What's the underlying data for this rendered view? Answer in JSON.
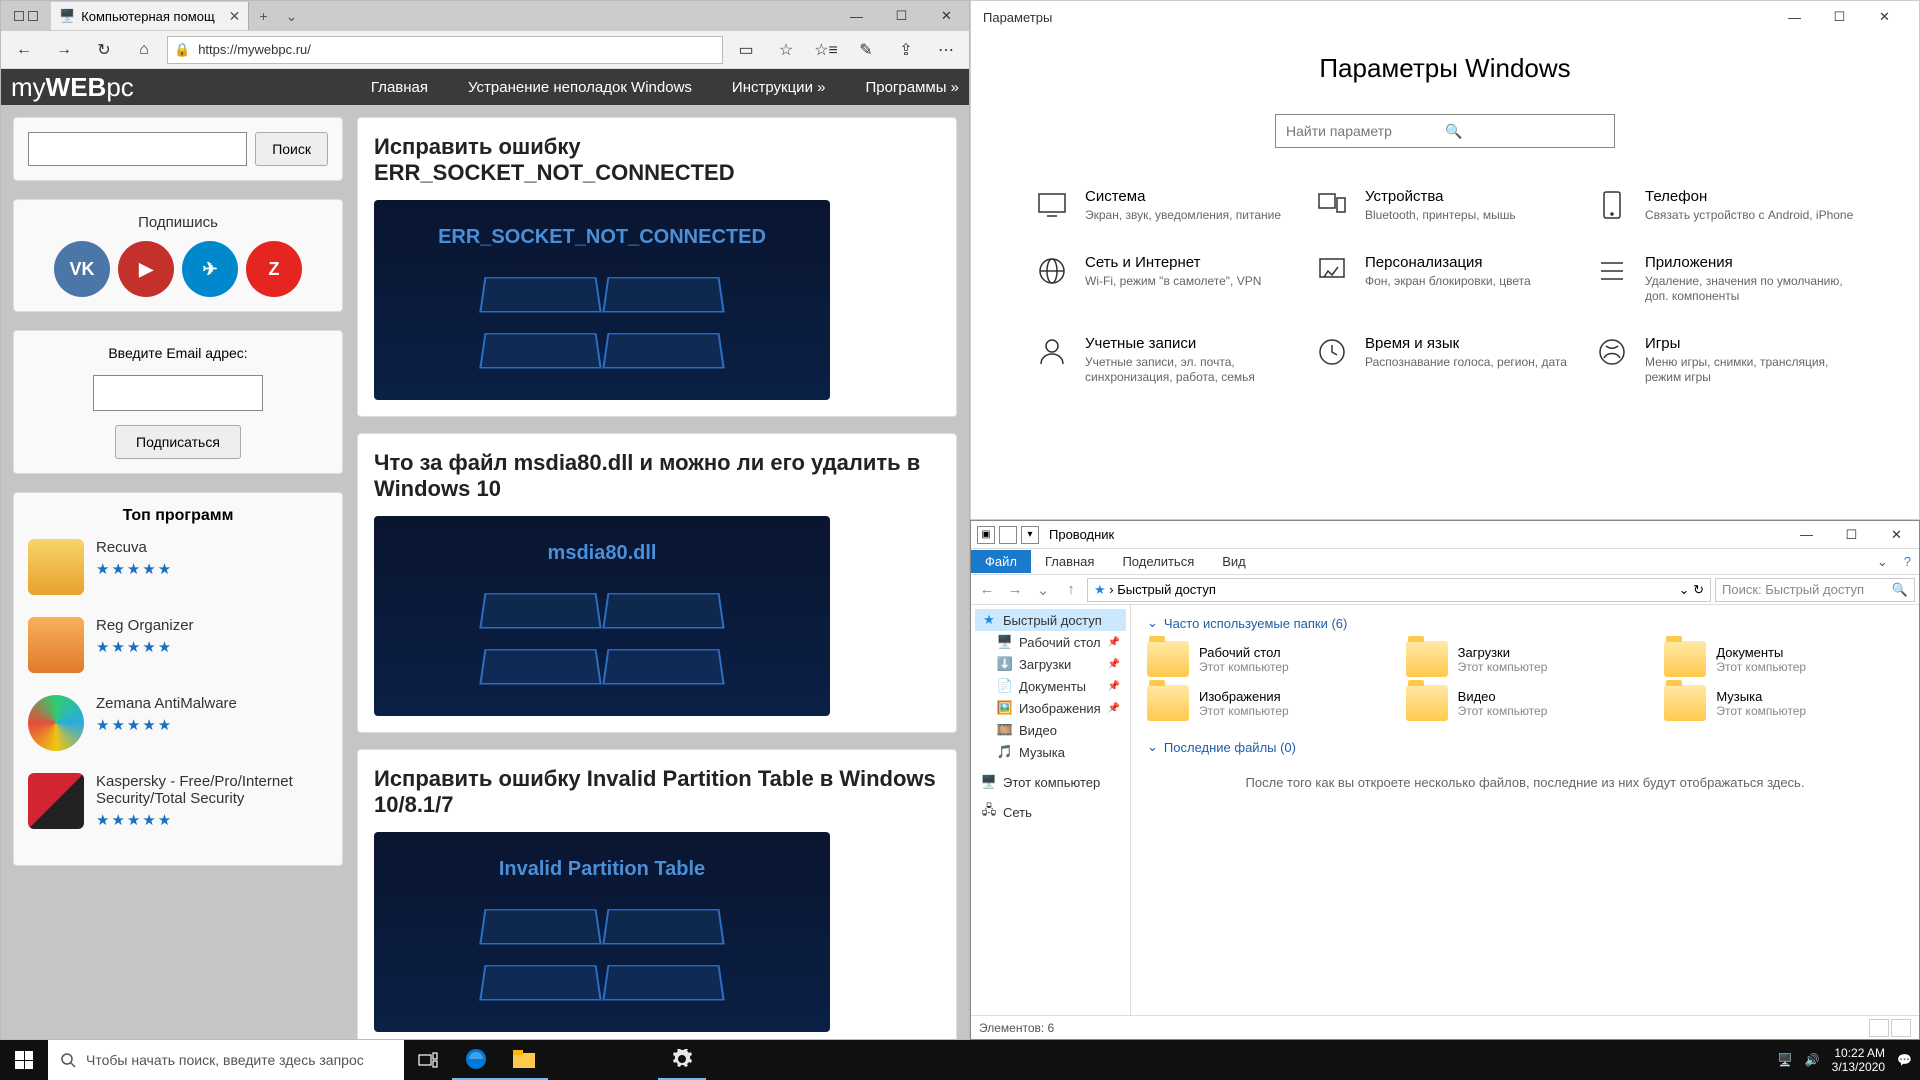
{
  "browser": {
    "tab_title": "Компьютерная помощ",
    "url": "https://mywebpc.ru/",
    "site_logo_a": "my",
    "site_logo_b": "WEB",
    "site_logo_c": "pc",
    "menu": [
      "Главная",
      "Устранение неполадок Windows",
      "Инструкции »",
      "Программы »"
    ],
    "search_btn": "Поиск",
    "subscribe_title": "Подпишись",
    "email_label": "Введите Email адрес:",
    "subscribe_btn": "Подписаться",
    "top_title": "Топ программ",
    "programs": [
      {
        "name": "Recuva",
        "color": "#f7b733"
      },
      {
        "name": "Reg Organizer",
        "color": "#f28c28"
      },
      {
        "name": "Zemana AntiMalware",
        "color": "#29abe2"
      },
      {
        "name": "Kaspersky - Free/Pro/Internet Security/Total Security",
        "color": "#d32431"
      }
    ],
    "articles": [
      {
        "title": "Исправить ошибку ERR_SOCKET_NOT_CONNECTED",
        "caption": "ERR_SOCKET_NOT_CONNECTED"
      },
      {
        "title": "Что за файл msdia80.dll и можно ли его удалить в Windows 10",
        "caption": "msdia80.dll"
      },
      {
        "title": "Исправить ошибку Invalid Partition Table в Windows 10/8.1/7",
        "caption": "Invalid Partition Table"
      }
    ]
  },
  "settings": {
    "window_title": "Параметры",
    "heading": "Параметры Windows",
    "search_placeholder": "Найти параметр",
    "items": [
      {
        "title": "Система",
        "desc": "Экран, звук, уведомления, питание"
      },
      {
        "title": "Устройства",
        "desc": "Bluetooth, принтеры, мышь"
      },
      {
        "title": "Телефон",
        "desc": "Связать устройство с Android, iPhone"
      },
      {
        "title": "Сеть и Интернет",
        "desc": "Wi-Fi, режим \"в самолете\", VPN"
      },
      {
        "title": "Персонализация",
        "desc": "Фон, экран блокировки, цвета"
      },
      {
        "title": "Приложения",
        "desc": "Удаление, значения по умолчанию, доп. компоненты"
      },
      {
        "title": "Учетные записи",
        "desc": "Учетные записи, эл. почта, синхронизация, работа, семья"
      },
      {
        "title": "Время и язык",
        "desc": "Распознавание голоса, регион, дата"
      },
      {
        "title": "Игры",
        "desc": "Меню игры, снимки, трансляция, режим игры"
      }
    ]
  },
  "explorer": {
    "title": "Проводник",
    "ribbon": {
      "file": "Файл",
      "home": "Главная",
      "share": "Поделиться",
      "view": "Вид"
    },
    "breadcrumb": "Быстрый доступ",
    "search_placeholder": "Поиск: Быстрый доступ",
    "tree": {
      "quick": "Быстрый доступ",
      "desktop": "Рабочий стол",
      "downloads": "Загрузки",
      "documents": "Документы",
      "pictures": "Изображения",
      "videos": "Видео",
      "music": "Музыка",
      "thispc": "Этот компьютер",
      "network": "Сеть"
    },
    "group1": "Часто используемые папки (6)",
    "folders": [
      {
        "name": "Рабочий стол",
        "sub": "Этот компьютер"
      },
      {
        "name": "Загрузки",
        "sub": "Этот компьютер"
      },
      {
        "name": "Документы",
        "sub": "Этот компьютер"
      },
      {
        "name": "Изображения",
        "sub": "Этот компьютер"
      },
      {
        "name": "Видео",
        "sub": "Этот компьютер"
      },
      {
        "name": "Музыка",
        "sub": "Этот компьютер"
      }
    ],
    "group2": "Последние файлы (0)",
    "empty": "После того как вы откроете несколько файлов, последние из них будут отображаться здесь.",
    "status": "Элементов: 6"
  },
  "taskbar": {
    "search_placeholder": "Чтобы начать поиск, введите здесь запрос",
    "time": "10:22 AM",
    "date": "3/13/2020"
  }
}
